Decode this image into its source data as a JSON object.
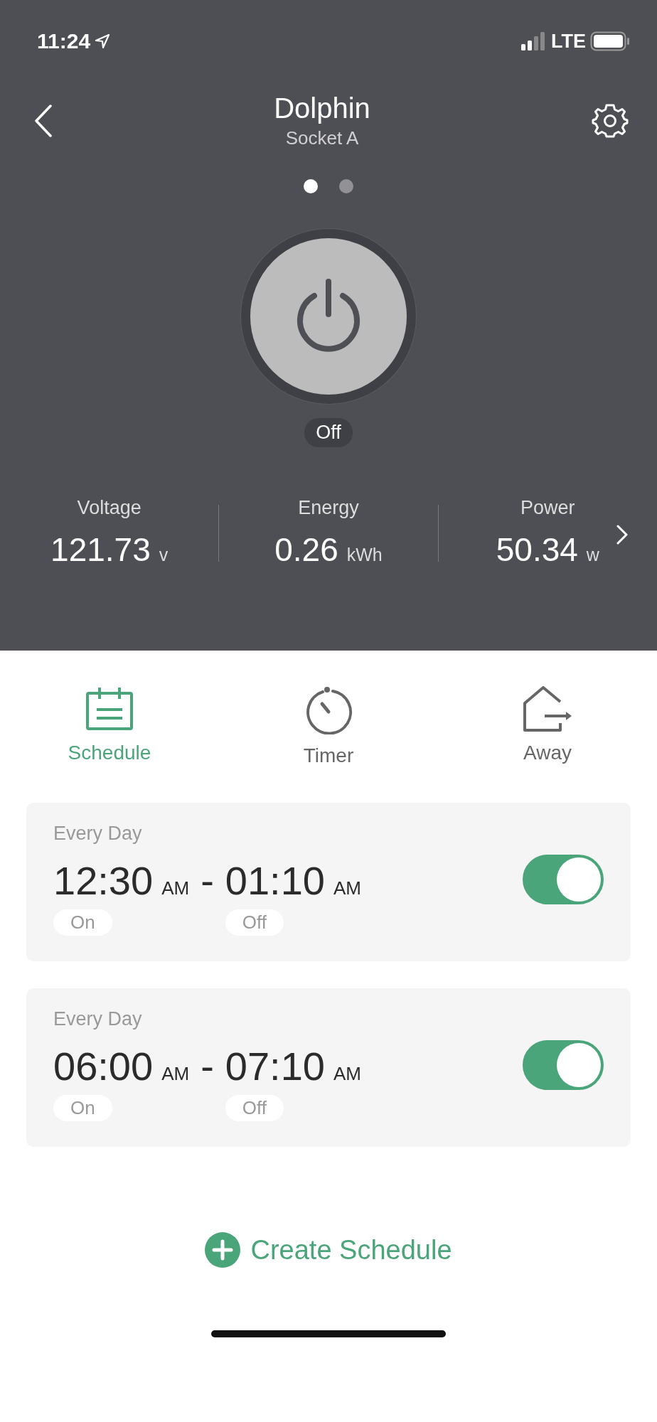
{
  "status_bar": {
    "time": "11:24",
    "network": "LTE"
  },
  "header": {
    "title": "Dolphin",
    "subtitle": "Socket A"
  },
  "pages": [
    {
      "selected": true
    },
    {
      "selected": false
    }
  ],
  "power": {
    "on": false,
    "state_label": "Off"
  },
  "stats": [
    {
      "label": "Voltage",
      "value": "121.73",
      "unit": "v"
    },
    {
      "label": "Energy",
      "value": "0.26",
      "unit": "kWh"
    },
    {
      "label": "Power",
      "value": "50.34",
      "unit": "w"
    }
  ],
  "tabs": [
    {
      "kind": "schedule",
      "label": "Schedule",
      "selected": true
    },
    {
      "kind": "timer",
      "label": "Timer",
      "selected": false
    },
    {
      "kind": "away",
      "label": "Away",
      "selected": false
    }
  ],
  "schedules": [
    {
      "repeat": "Every Day",
      "start": "12:30",
      "start_period": "AM",
      "separator": "-",
      "end": "01:10",
      "end_period": "AM",
      "start_label": "On",
      "end_label": "Off",
      "enabled": true
    },
    {
      "repeat": "Every Day",
      "start": "06:00",
      "start_period": "AM",
      "separator": "-",
      "end": "07:10",
      "end_period": "AM",
      "start_label": "On",
      "end_label": "Off",
      "enabled": true
    }
  ],
  "create_button": {
    "label": "Create Schedule"
  }
}
